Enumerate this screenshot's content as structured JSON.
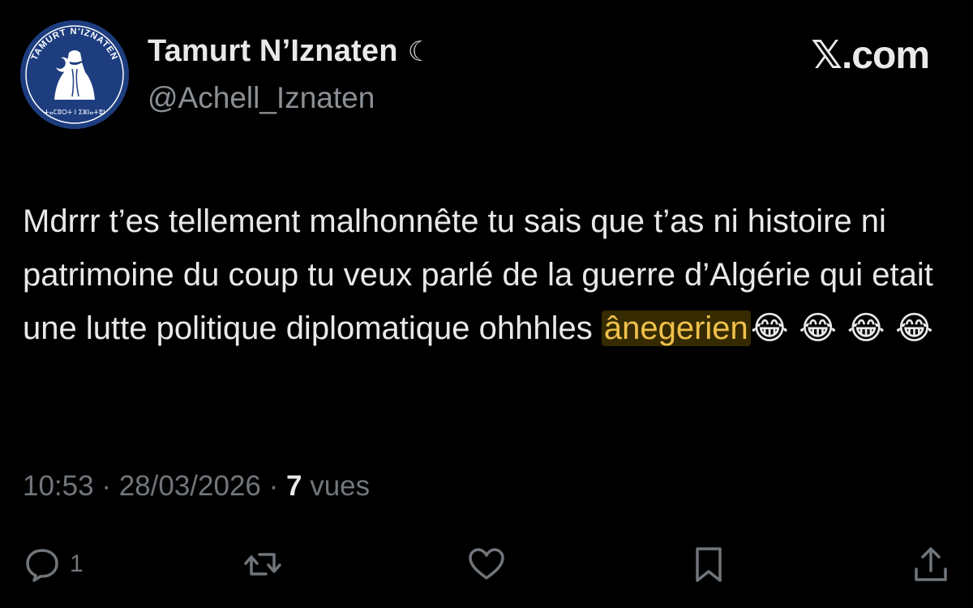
{
  "author": {
    "display_name": "Tamurt N’Iznaten",
    "moon_symbol": "☾",
    "handle": "@Achell_Iznaten",
    "avatar_text": "TAMURT N'IZNATEN",
    "avatar_subtext": "ⵜⴰⵎⵓⵔⵜ ⵏ ⵉⵣⵏⴰⵜⴻⵏ",
    "avatar_color": "#1d3d7f"
  },
  "brand": "𝕏.com",
  "tweet": {
    "text_before": "Mdrrr t’es tellement malhonnête tu sais que t’as ni histoire ni patrimoine du coup tu veux parlé de la guerre d’Algérie qui etait une lutte politique diplomatique ohhhles ",
    "highlighted": "ânegerien",
    "emojis": "😂 😂 😂 😂",
    "highlight_color": "#f0c04a"
  },
  "meta": {
    "time": "10:53",
    "separator": " · ",
    "date": "28/03/2026",
    "views_count": "7",
    "views_label": "vues"
  },
  "actions": {
    "reply_count": "1",
    "icons": [
      "reply-icon",
      "retweet-icon",
      "like-icon",
      "bookmark-icon",
      "share-icon"
    ]
  }
}
